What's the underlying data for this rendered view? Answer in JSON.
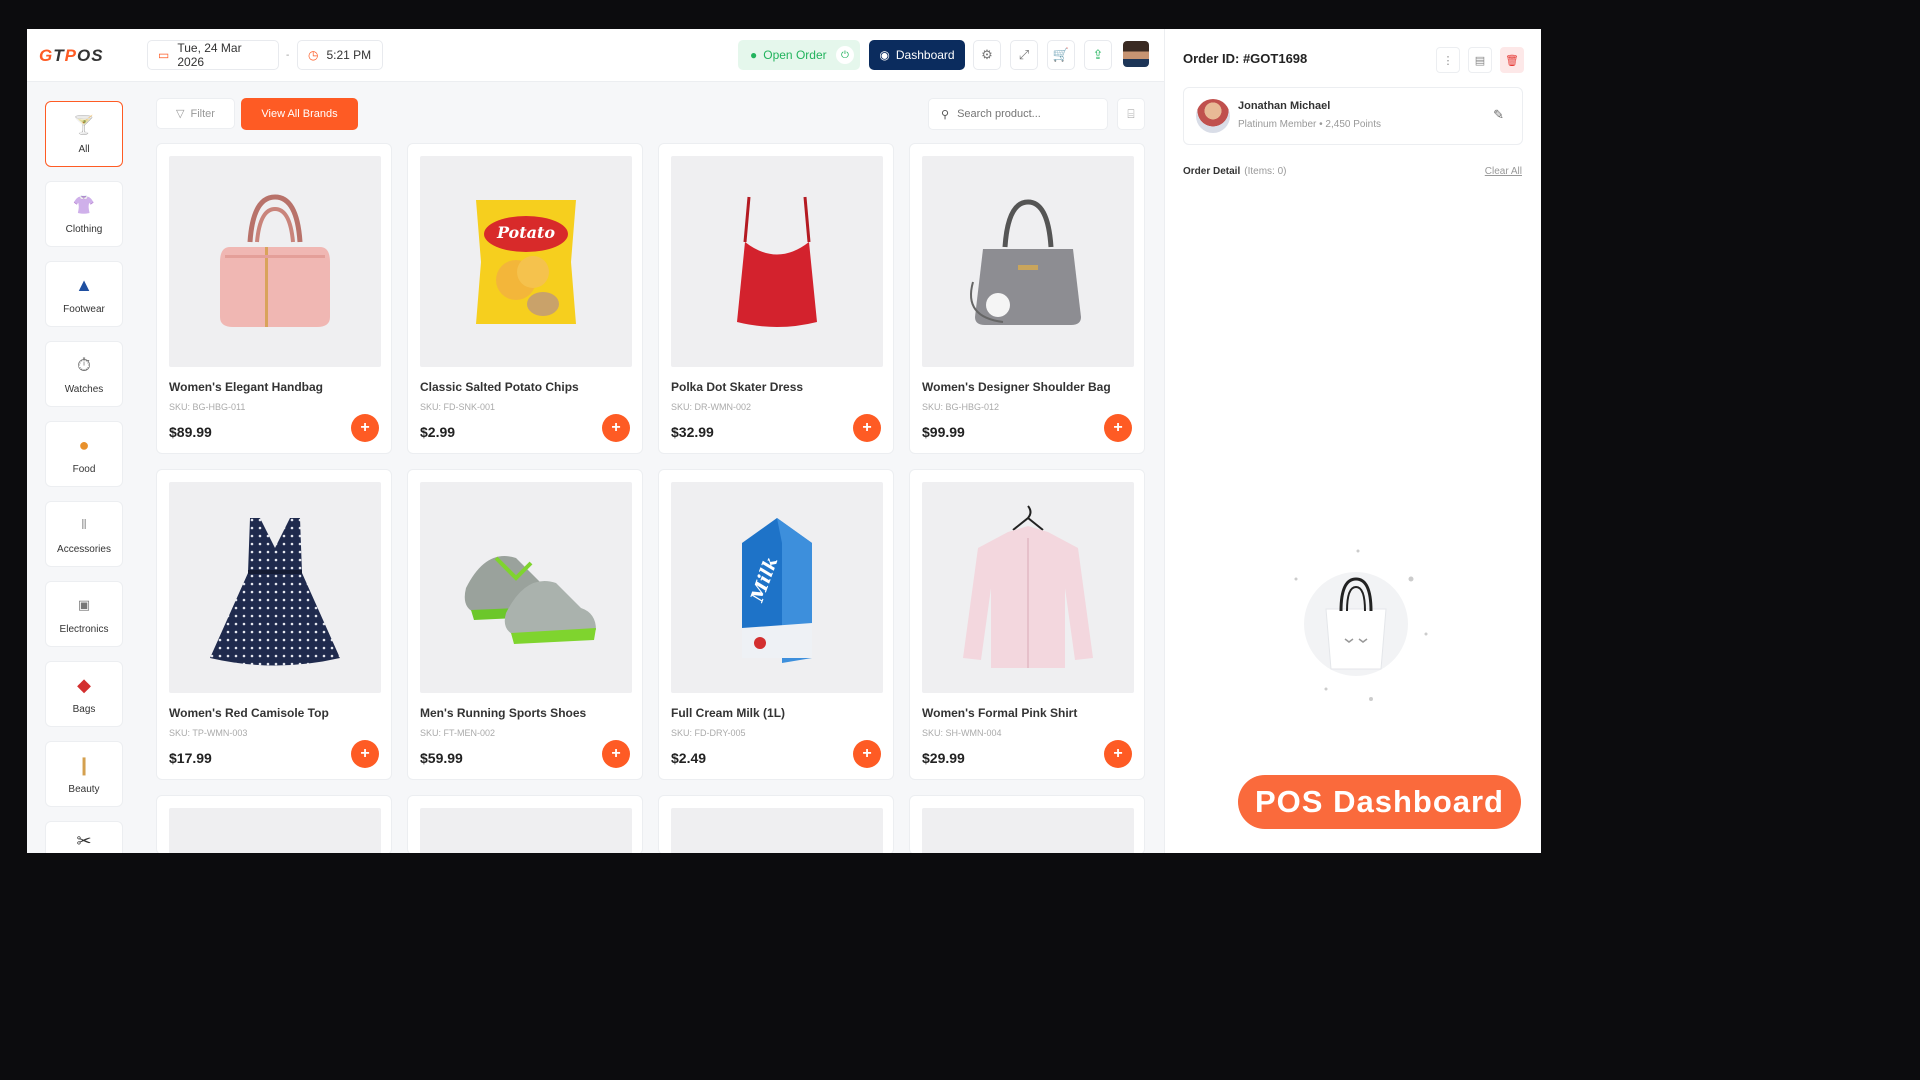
{
  "app": {
    "logo_prefix": "G",
    "logo_mid": "T",
    "logo_o": "P",
    "logo_suffix": "OS"
  },
  "topbar": {
    "date": "Tue, 24 Mar 2026",
    "time": "5:21 PM",
    "open_order_label": "Open Order",
    "dashboard_label": "Dashboard"
  },
  "categories": [
    {
      "label": "All",
      "icon": "glass-icon"
    },
    {
      "label": "Clothing",
      "icon": "sweater-icon"
    },
    {
      "label": "Footwear",
      "icon": "shoe-icon"
    },
    {
      "label": "Watches",
      "icon": "watch-icon"
    },
    {
      "label": "Food",
      "icon": "food-icon"
    },
    {
      "label": "Accessories",
      "icon": "accessories-icon"
    },
    {
      "label": "Electronics",
      "icon": "electronics-icon"
    },
    {
      "label": "Bags",
      "icon": "bag-icon"
    },
    {
      "label": "Beauty",
      "icon": "beauty-icon"
    }
  ],
  "toolbar": {
    "filter_label": "Filter",
    "brands_label": "View All Brands",
    "search_placeholder": "Search product..."
  },
  "products": [
    {
      "name": "Women's Elegant Handbag",
      "sku": "SKU: BG-HBG-011",
      "price": "$89.99"
    },
    {
      "name": "Classic Salted Potato Chips",
      "sku": "SKU: FD-SNK-001",
      "price": "$2.99"
    },
    {
      "name": "Polka Dot Skater Dress",
      "sku": "SKU: DR-WMN-002",
      "price": "$32.99"
    },
    {
      "name": "Women's Designer Shoulder Bag",
      "sku": "SKU: BG-HBG-012",
      "price": "$99.99"
    },
    {
      "name": "Women's Red Camisole Top",
      "sku": "SKU: TP-WMN-003",
      "price": "$17.99"
    },
    {
      "name": "Men's Running Sports Shoes",
      "sku": "SKU: FT-MEN-002",
      "price": "$59.99"
    },
    {
      "name": "Full Cream Milk (1L)",
      "sku": "SKU: FD-DRY-005",
      "price": "$2.49"
    },
    {
      "name": "Women's Formal Pink Shirt",
      "sku": "SKU: SH-WMN-004",
      "price": "$29.99"
    }
  ],
  "order": {
    "id_label": "Order ID: #GOT1698",
    "customer_name": "Jonathan Michael",
    "customer_meta": "Platinum Member • 2,450 Points",
    "detail_label": "Order Detail",
    "items_count": "(Items: 0)",
    "clear_all": "Clear All"
  },
  "badge": {
    "label": "POS Dashboard"
  },
  "colors": {
    "accent": "#fe5b24",
    "navy": "#0b2c5e",
    "success": "#22b35d"
  }
}
